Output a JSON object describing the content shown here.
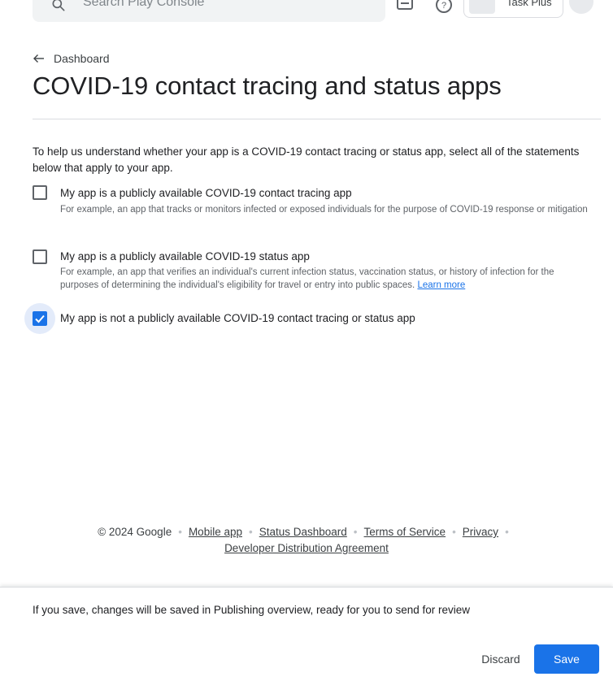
{
  "topbar": {
    "search_placeholder": "Search Play Console",
    "app_name": "Task Plus",
    "icons": [
      "search-icon",
      "feedback-icon",
      "help-icon",
      "app-thumbnail",
      "side-panel-icon"
    ]
  },
  "header": {
    "back_label": "Dashboard",
    "title": "COVID-19 contact tracing and status apps"
  },
  "intro": "To help us understand whether your app is a COVID-19 contact tracing or status app, select all of the statements below that apply to your app.",
  "options": [
    {
      "label": "My app is a publicly available COVID-19 contact tracing app",
      "help": "For example, an app that tracks or monitors infected or exposed individuals for the purpose of COVID-19 response or mitigation",
      "checked": false
    },
    {
      "label": "My app is a publicly available COVID-19 status app",
      "help": "For example, an app that verifies an individual's current infection status, vaccination status, or history of infection for the purposes of determining the individual's eligibility for travel or entry into public spaces.",
      "link": "Learn more",
      "checked": false
    },
    {
      "label": "My app is not a publicly available COVID-19 contact tracing or status app",
      "checked": true
    }
  ],
  "footer": {
    "copyright": "© 2024 Google",
    "links": [
      "Mobile app",
      "Status Dashboard",
      "Terms of Service",
      "Privacy",
      "Developer Distribution Agreement"
    ]
  },
  "save_bar": {
    "message": "If you save, changes will be saved in Publishing overview, ready for you to send for review",
    "discard_label": "Discard",
    "save_label": "Save"
  },
  "colors": {
    "accent": "#1a73e8",
    "text": "#202124",
    "muted": "#5f6368"
  }
}
